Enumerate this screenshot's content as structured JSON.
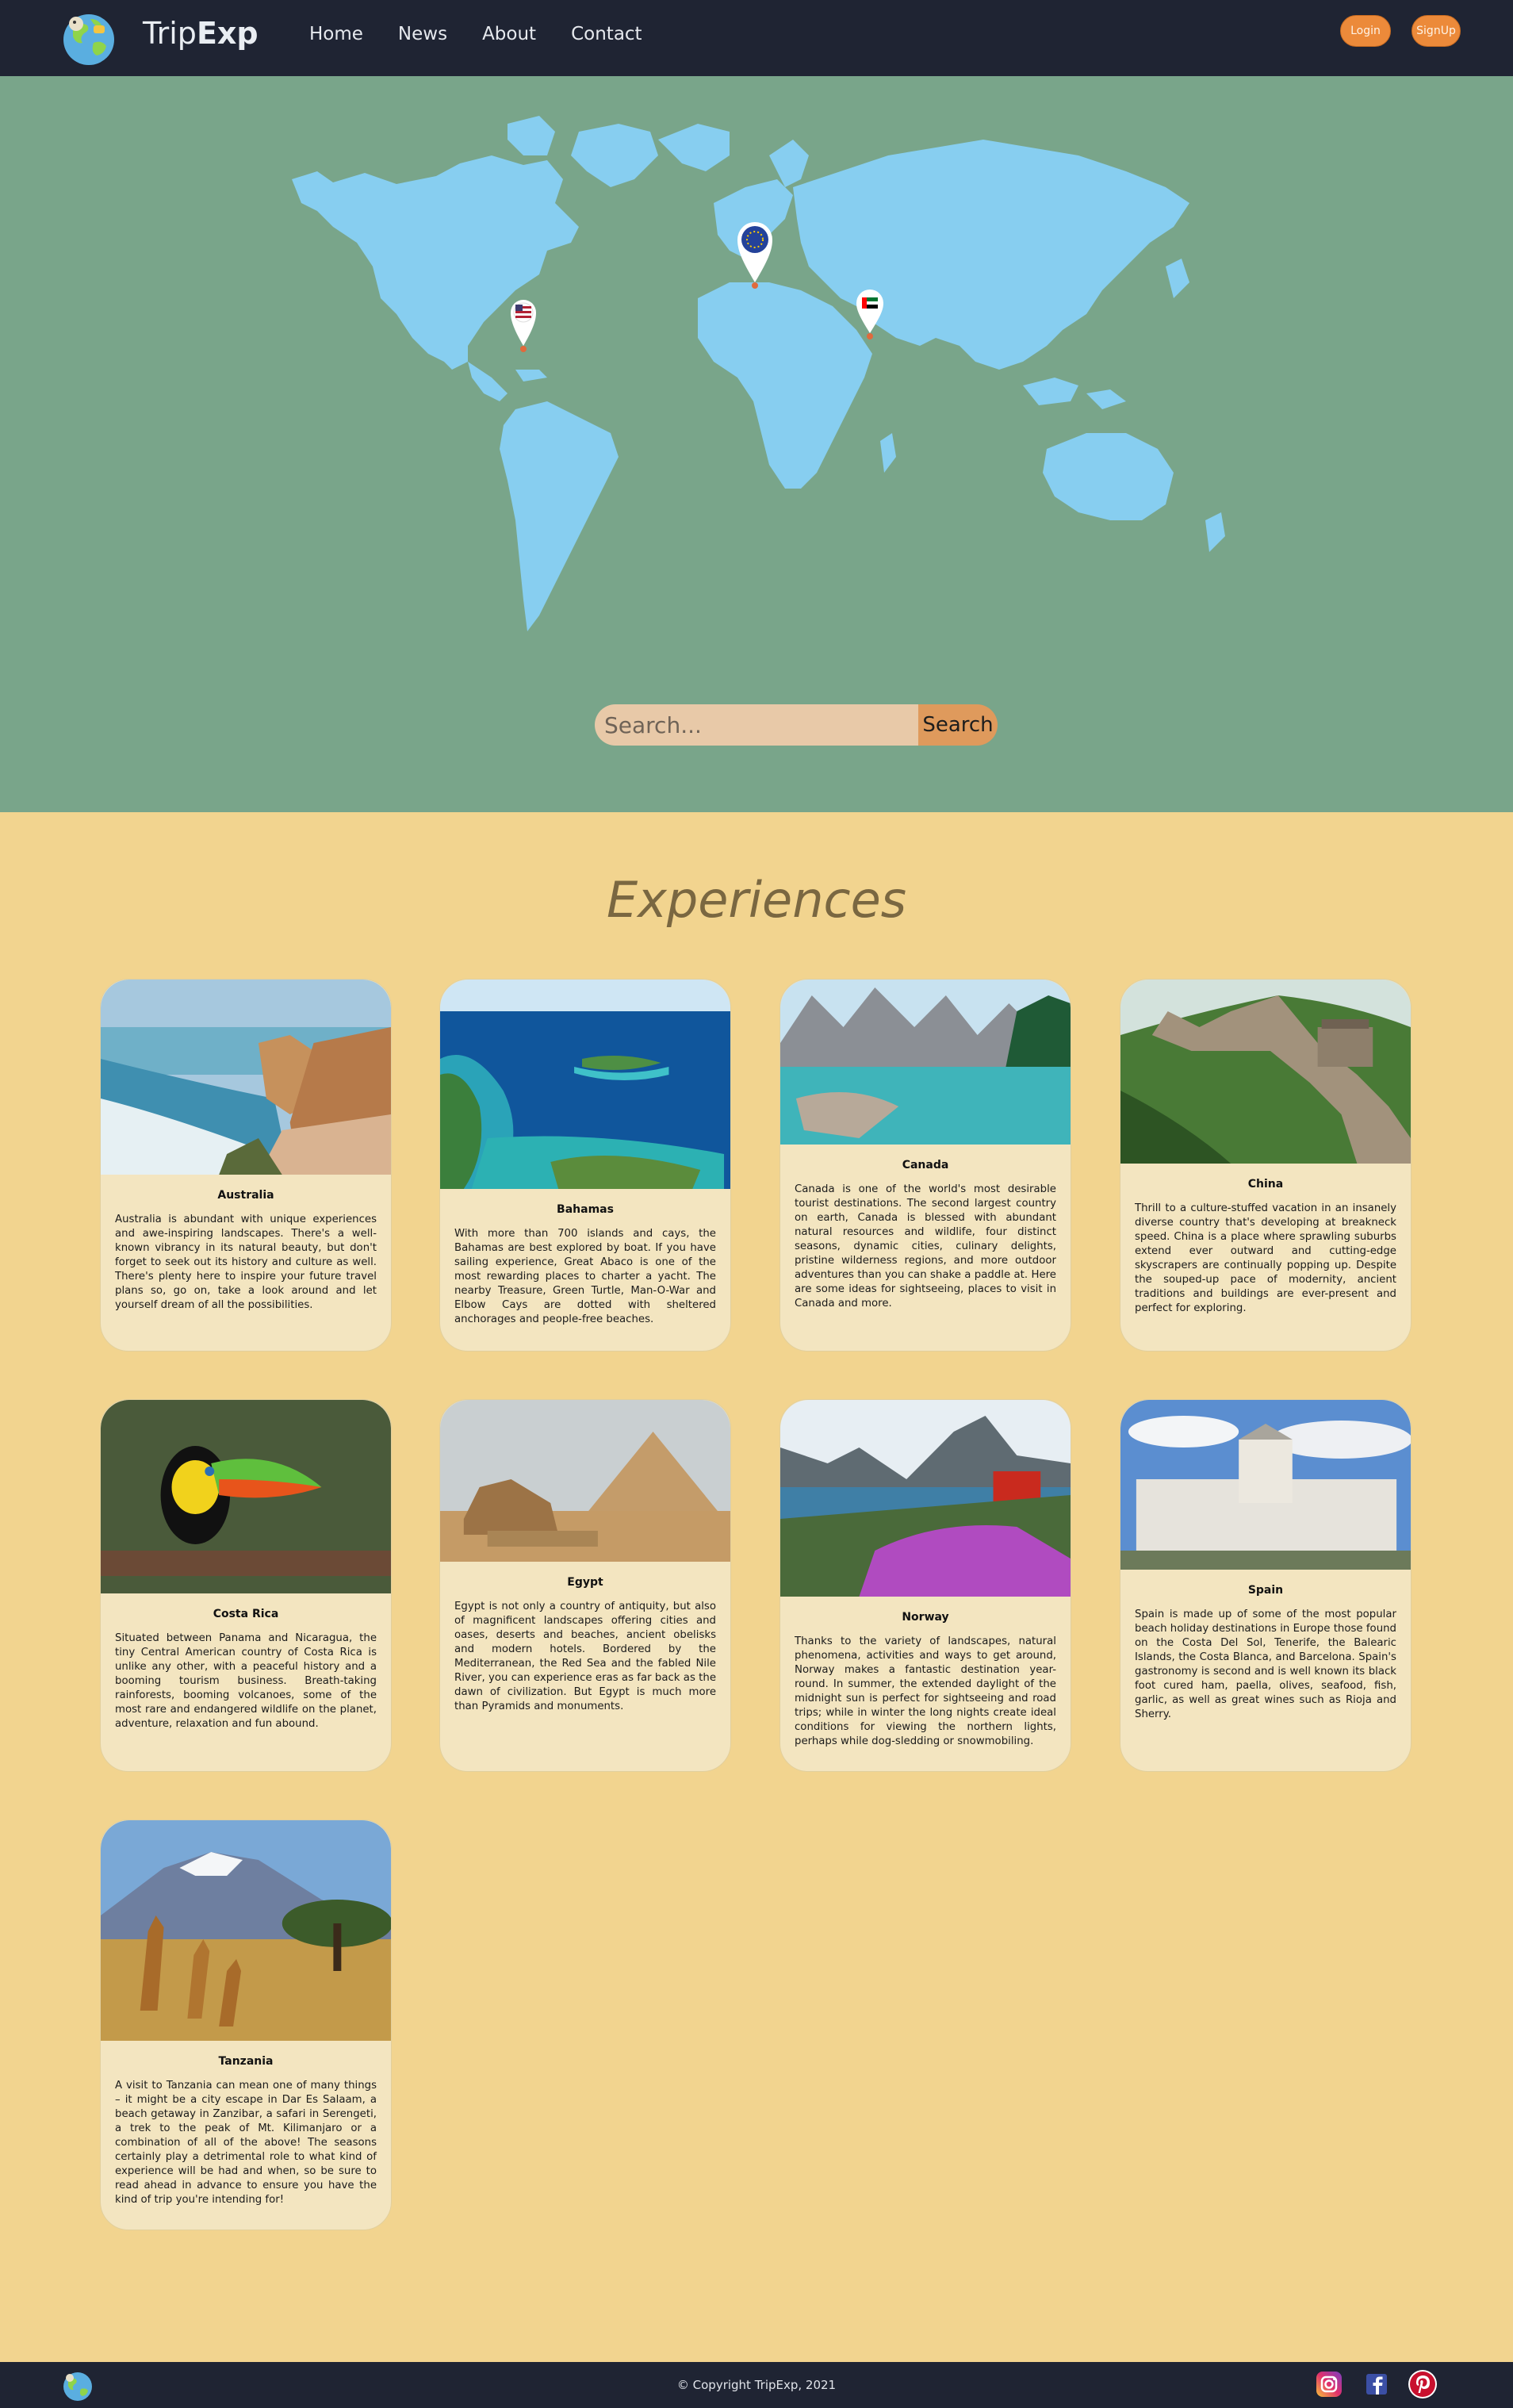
{
  "nav": {
    "brand_light": "Trip",
    "brand_bold": "Exp",
    "links": [
      "Home",
      "News",
      "About",
      "Contact"
    ],
    "login_label": "Login",
    "signup_label": "SignUp"
  },
  "hero": {
    "search_placeholder": "Search...",
    "search_button": "Search",
    "map_pins": [
      "us-flag",
      "eu-flag",
      "uae-flag"
    ]
  },
  "experiences": {
    "title": "Experiences",
    "cards": [
      {
        "name": "Australia",
        "text": "Australia is abundant with unique experiences and awe-inspiring landscapes. There's a well-known vibrancy in its natural beauty, but don't forget to seek out its history and culture as well. There's plenty here to inspire your future travel plans so, go on, take a look around and let yourself dream of all the possibilities."
      },
      {
        "name": "Bahamas",
        "text": "With more than 700 islands and cays, the Bahamas are best explored by boat. If you have sailing experience, Great Abaco is one of the most rewarding places to charter a yacht. The nearby Treasure, Green Turtle, Man-O-War and Elbow Cays are dotted with sheltered anchorages and people-free beaches."
      },
      {
        "name": "Canada",
        "text": "Canada is one of the world's most desirable tourist destinations. The second largest country on earth, Canada is blessed with abundant natural resources and wildlife, four distinct seasons, dynamic cities, culinary delights, pristine wilderness regions, and more outdoor adventures than you can shake a paddle at. Here are some ideas for sightseeing, places to visit in Canada and more."
      },
      {
        "name": "China",
        "text": "Thrill to a culture-stuffed vacation in an insanely diverse country that's developing at breakneck speed. China is a place where sprawling suburbs extend ever outward and cutting-edge skyscrapers are continually popping up. Despite the souped-up pace of modernity, ancient traditions and buildings are ever-present and perfect for exploring."
      },
      {
        "name": "Costa Rica",
        "text": "Situated between Panama and Nicaragua, the tiny Central American country of Costa Rica is unlike any other, with a peaceful history and a booming tourism business. Breath-taking rainforests, booming volcanoes, some of the most rare and endangered wildlife on the planet, adventure, relaxation and fun abound."
      },
      {
        "name": "Egypt",
        "text": "Egypt is not only a country of antiquity, but also of magnificent landscapes offering cities and oases, deserts and beaches, ancient obelisks and modern hotels. Bordered by the Mediterranean, the Red Sea and the fabled Nile River, you can experience eras as far back as the dawn of civilization. But Egypt is much more than Pyramids and monuments."
      },
      {
        "name": "Norway",
        "text": "Thanks to the variety of landscapes, natural phenomena, activities and ways to get around, Norway makes a fantastic destination year-round. In summer, the extended daylight of the midnight sun is perfect for sightseeing and road trips; while in winter the long nights create ideal conditions for viewing the northern lights, perhaps while dog-sledding or snowmobiling."
      },
      {
        "name": "Spain",
        "text": "Spain is made up of some of the most popular beach holiday destinations in Europe those found on the Costa Del Sol, Tenerife, the Balearic Islands, the Costa Blanca, and Barcelona. Spain's gastronomy is second and is well known its black foot cured ham, paella, olives, seafood, fish, garlic, as well as great wines such as Rioja and Sherry."
      },
      {
        "name": "Tanzania",
        "text": "A visit to Tanzania can mean one of many things – it might be a city escape in Dar Es Salaam, a beach getaway in Zanzibar, a safari in Serengeti, a trek to the peak of Mt. Kilimanjaro or a combination of all of the above! The seasons certainly play a detrimental role to what kind of experience will be had and when, so be sure to read ahead in advance to ensure you have the kind of trip you're intending for!"
      }
    ]
  },
  "footer": {
    "copyright": "© Copyright TripExp, 2021",
    "social": [
      "instagram-icon",
      "facebook-icon",
      "pinterest-icon"
    ]
  },
  "colors": {
    "nav_bg": "#1f2433",
    "hero_bg": "#79a58a",
    "map_land": "#87cef0",
    "page_bg": "#f2d48f",
    "card_bg": "#f3e5c0",
    "accent": "#ec8a3a"
  }
}
